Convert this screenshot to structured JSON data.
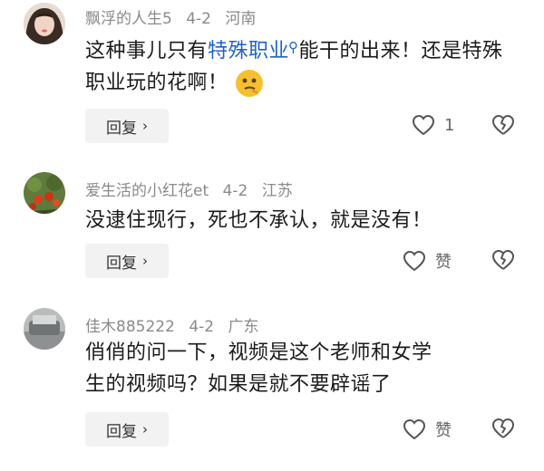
{
  "comments": [
    {
      "username": "飘浮的人生5",
      "date": "4-2",
      "location": "河南",
      "text_before": "这种事儿只有",
      "link_text": "特殊职业",
      "text_after": "能干的出来！还是特殊职业玩的花啊！",
      "reply_label": "回复",
      "like_count": "1"
    },
    {
      "username": "爱生活的小红花et",
      "date": "4-2",
      "location": "江苏",
      "text": "没逮住现行，死也不承认，就是没有！",
      "reply_label": "回复",
      "like_label": "赞"
    },
    {
      "username": "佳木885222",
      "date": "4-2",
      "location": "广东",
      "text": "俏俏的问一下，视频是这个老师和女学生的视频吗？如果是就不要辟谣了",
      "reply_label": "回复",
      "like_label": "赞"
    }
  ],
  "icons": {
    "heart": "heart-icon",
    "broken_heart": "broken-heart-icon",
    "search": "search-icon",
    "chevron": "chevron-right-icon"
  }
}
